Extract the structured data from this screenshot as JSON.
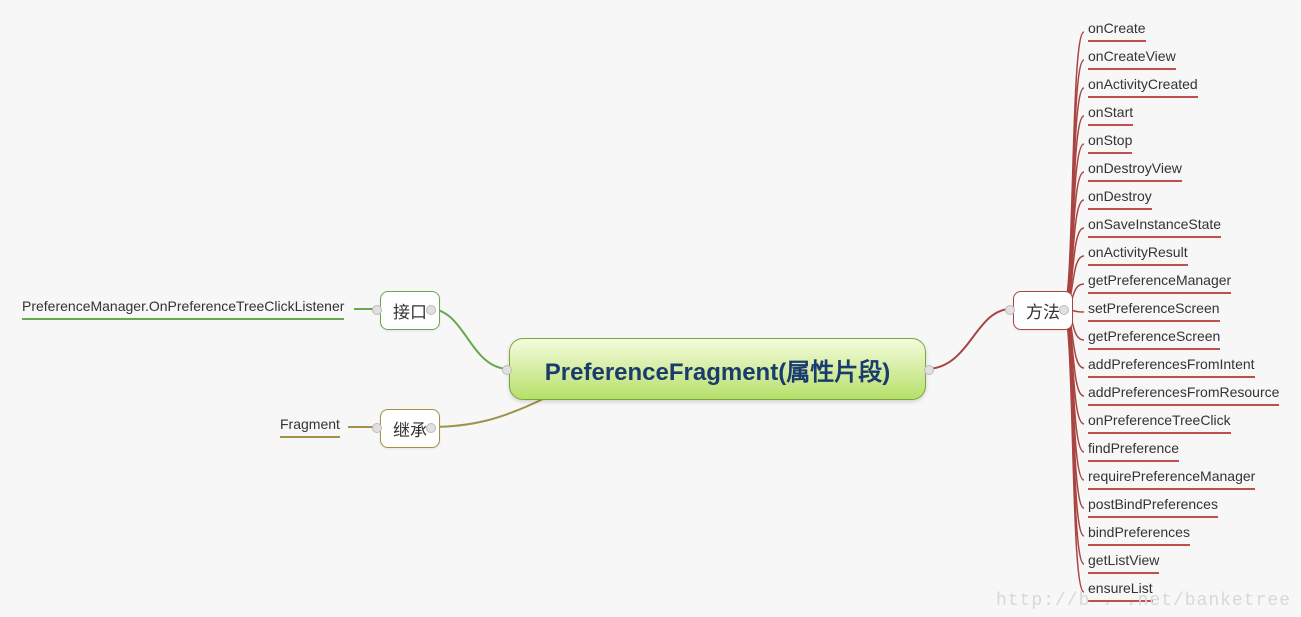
{
  "root": {
    "label": "PreferenceFragment(属性片段)"
  },
  "branches": {
    "interface": {
      "label": "接口",
      "leaf": "PreferenceManager.OnPreferenceTreeClickListener"
    },
    "extends": {
      "label": "继承",
      "leaf": "Fragment"
    },
    "methods": {
      "label": "方法"
    }
  },
  "methods": [
    "onCreate",
    "onCreateView",
    "onActivityCreated",
    "onStart",
    "onStop",
    "onDestroyView",
    "onDestroy",
    "onSaveInstanceState",
    "onActivityResult",
    "getPreferenceManager",
    "setPreferenceScreen",
    "getPreferenceScreen",
    "addPreferencesFromIntent",
    "addPreferencesFromResource",
    "onPreferenceTreeClick",
    "findPreference",
    "requirePreferenceManager",
    "postBindPreferences",
    "bindPreferences",
    "getListView",
    "ensureList"
  ],
  "watermark": "http://b   .    .net/banketree",
  "chart_data": {
    "type": "mindmap",
    "root": "PreferenceFragment(属性片段)",
    "branches": [
      {
        "name": "接口",
        "side": "left",
        "color": "green",
        "children": [
          "PreferenceManager.OnPreferenceTreeClickListener"
        ]
      },
      {
        "name": "继承",
        "side": "left",
        "color": "olive",
        "children": [
          "Fragment"
        ]
      },
      {
        "name": "方法",
        "side": "right",
        "color": "red",
        "children": [
          "onCreate",
          "onCreateView",
          "onActivityCreated",
          "onStart",
          "onStop",
          "onDestroyView",
          "onDestroy",
          "onSaveInstanceState",
          "onActivityResult",
          "getPreferenceManager",
          "setPreferenceScreen",
          "getPreferenceScreen",
          "addPreferencesFromIntent",
          "addPreferencesFromResource",
          "onPreferenceTreeClick",
          "findPreference",
          "requirePreferenceManager",
          "postBindPreferences",
          "bindPreferences",
          "getListView",
          "ensureList"
        ]
      }
    ]
  }
}
